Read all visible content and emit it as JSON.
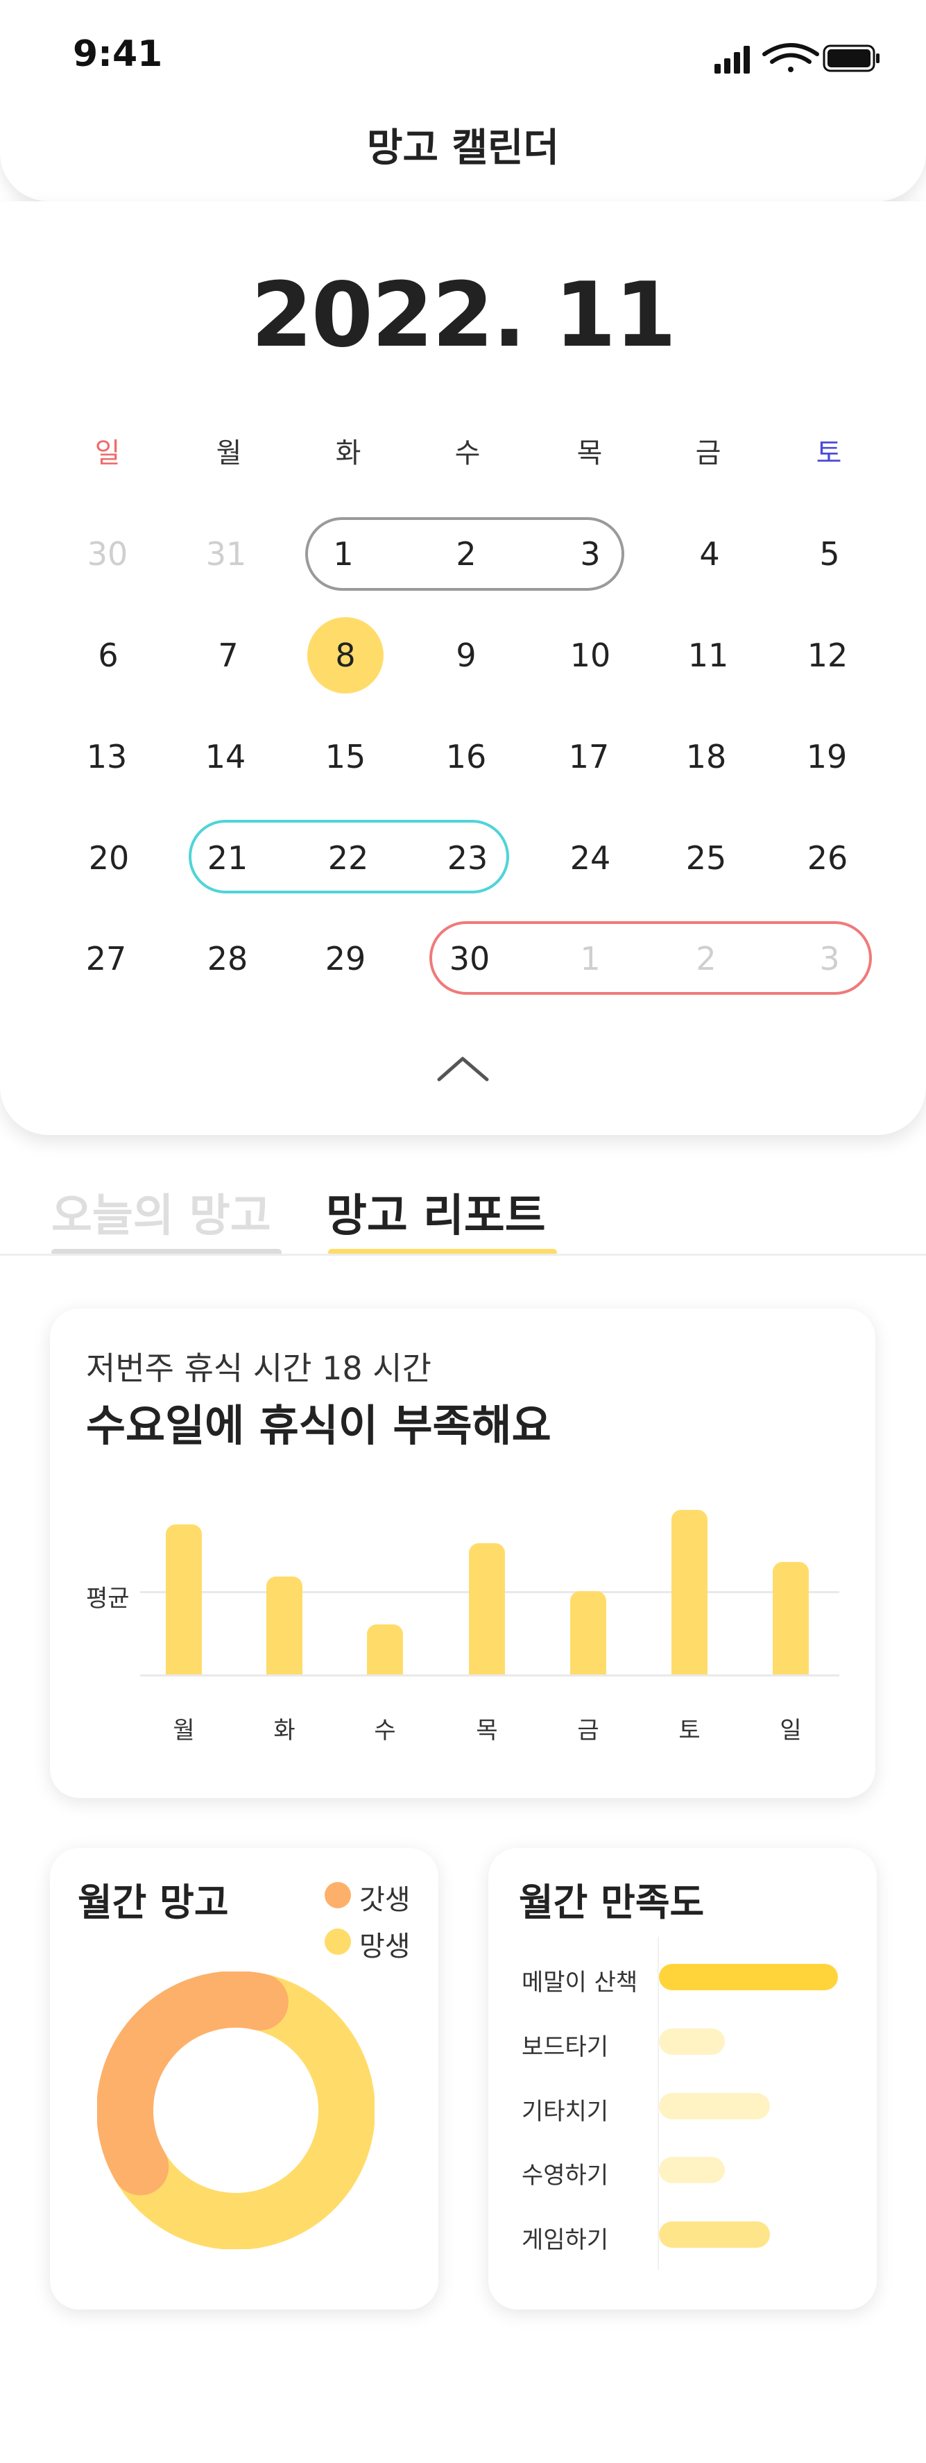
{
  "status_bar": {
    "time": "9:41"
  },
  "header": {
    "title": "망고 캘린더"
  },
  "calendar": {
    "month_title": "2022. 11",
    "weekdays": [
      "일",
      "월",
      "화",
      "수",
      "목",
      "금",
      "토"
    ],
    "weekday_colors": {
      "sunday": "#F06B6B",
      "saturday": "#4B4BD6"
    },
    "weeks": [
      [
        "30",
        "31",
        "1",
        "2",
        "3",
        "4",
        "5"
      ],
      [
        "6",
        "7",
        "8",
        "9",
        "10",
        "11",
        "12"
      ],
      [
        "13",
        "14",
        "15",
        "16",
        "17",
        "18",
        "19"
      ],
      [
        "20",
        "21",
        "22",
        "23",
        "24",
        "25",
        "26"
      ],
      [
        "27",
        "28",
        "29",
        "30",
        "1",
        "2",
        "3"
      ]
    ],
    "today": "8",
    "range_colors": {
      "gray": "#9A9A9A",
      "teal": "#4FD4D8",
      "red": "#F07A7A",
      "today": "#FFDC6A"
    }
  },
  "tabs": [
    {
      "label": "오늘의 망고",
      "active": false
    },
    {
      "label": "망고 리포트",
      "active": true
    }
  ],
  "report": {
    "subtitle": "저번주 휴식 시간 18 시간",
    "headline": "수요일에 휴식이 부족해요",
    "avg_label": "평균",
    "chart_data": {
      "type": "bar",
      "categories": [
        "월",
        "화",
        "수",
        "목",
        "금",
        "토",
        "일"
      ],
      "values": [
        7.2,
        4.7,
        2.4,
        6.3,
        4.0,
        7.9,
        5.4
      ],
      "average": 4.0,
      "ylim": [
        0,
        8
      ],
      "grid": false,
      "bar_color": "#FFDC6A"
    }
  },
  "monthly_mango": {
    "title": "월간 망고",
    "legend": [
      {
        "label": "갓생",
        "color": "#FDB06A"
      },
      {
        "label": "망생",
        "color": "#FFDC6A"
      }
    ],
    "chart_data": {
      "type": "pie",
      "categories": [
        "갓생",
        "망생"
      ],
      "values": [
        37,
        63
      ]
    }
  },
  "monthly_satisfaction": {
    "title": "월간 만족도",
    "items": [
      {
        "label": "메말이 산책",
        "value": 1.0,
        "color": "#FFD43B"
      },
      {
        "label": "보드타기",
        "value": 0.37,
        "color": "#FFF3C4"
      },
      {
        "label": "기타치기",
        "value": 0.62,
        "color": "#FFF3C4"
      },
      {
        "label": "수영하기",
        "value": 0.37,
        "color": "#FFF3C4"
      },
      {
        "label": "게임하기",
        "value": 0.62,
        "color": "#FFE58A"
      }
    ]
  }
}
